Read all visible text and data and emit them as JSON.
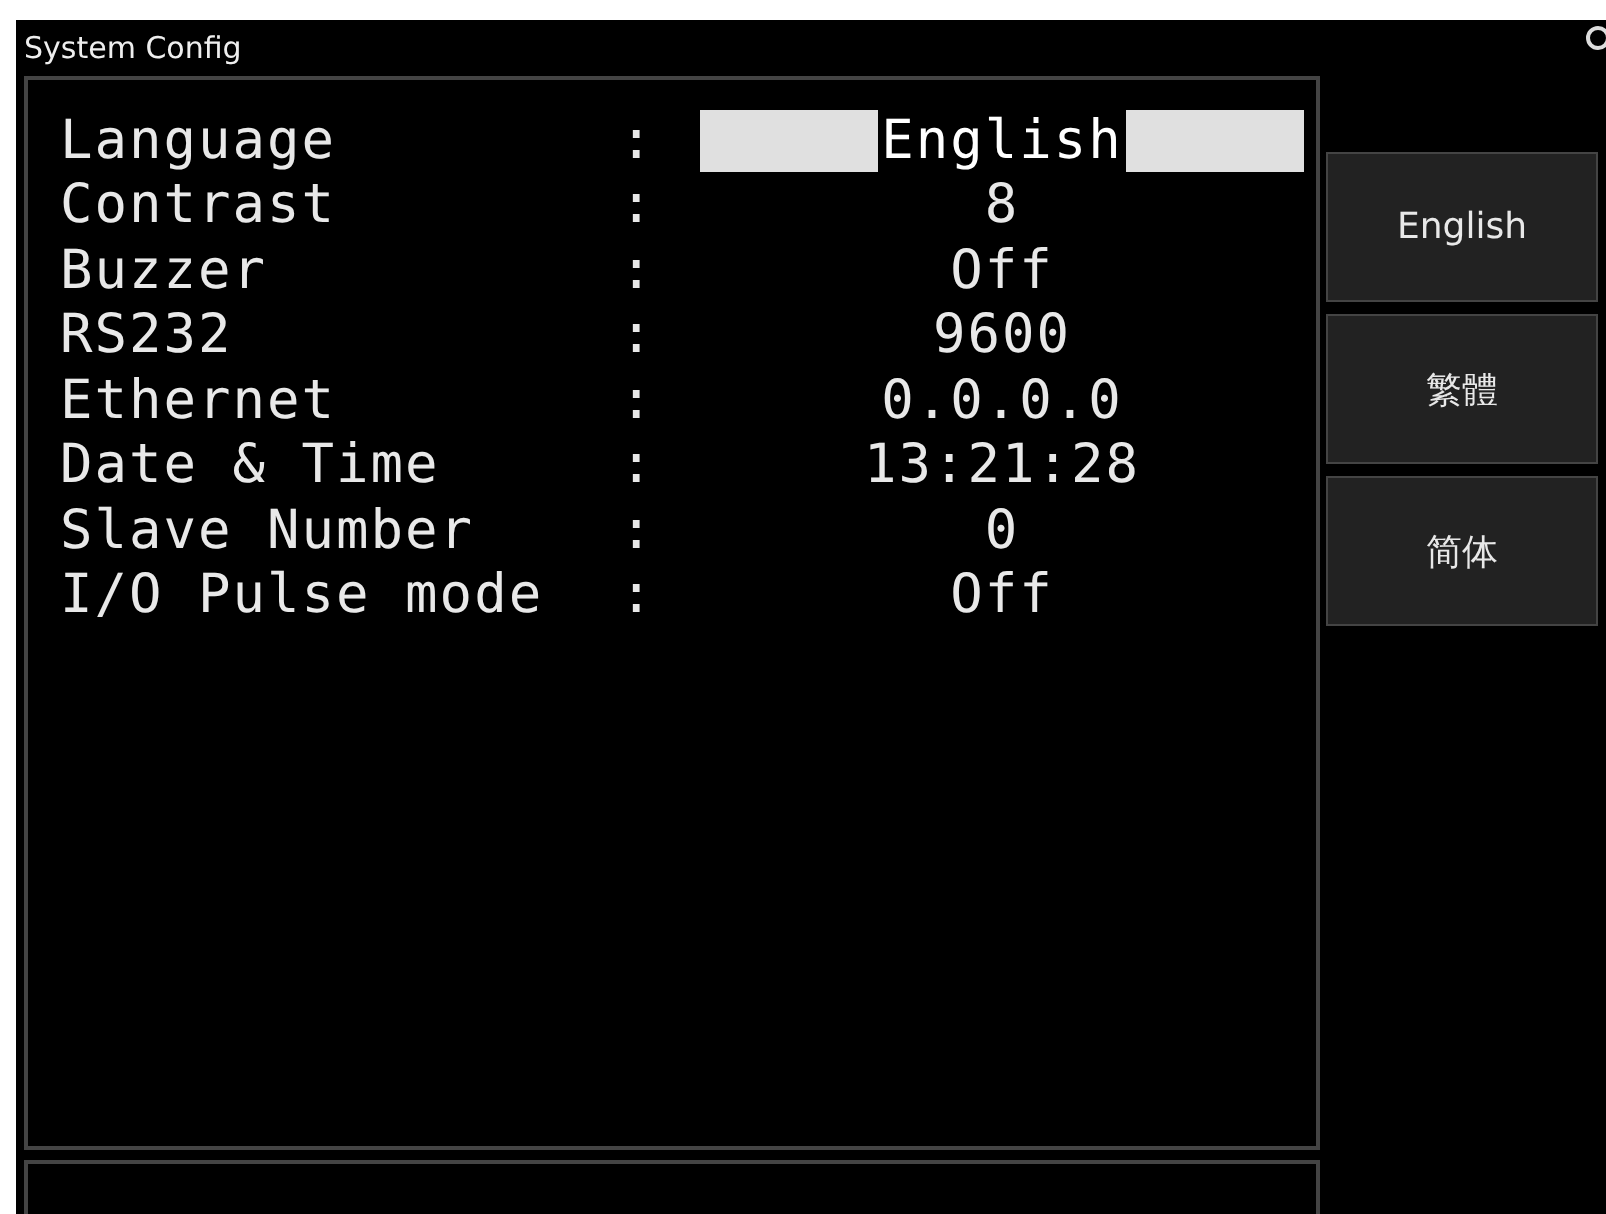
{
  "window": {
    "title": "System Config"
  },
  "settings": [
    {
      "label": "Language",
      "value": "English",
      "selected": true
    },
    {
      "label": "Contrast",
      "value": "8",
      "selected": false
    },
    {
      "label": "Buzzer",
      "value": "Off",
      "selected": false
    },
    {
      "label": "RS232",
      "value": "9600",
      "selected": false
    },
    {
      "label": "Ethernet",
      "value": "0.0.0.0",
      "selected": false
    },
    {
      "label": "Date & Time",
      "value": "13:21:28",
      "selected": false
    },
    {
      "label": "Slave Number",
      "value": "0",
      "selected": false
    },
    {
      "label": "I/O Pulse mode",
      "value": "Off",
      "selected": false
    }
  ],
  "separator": ":",
  "softkeys": [
    "English",
    "繁體",
    "简体"
  ]
}
